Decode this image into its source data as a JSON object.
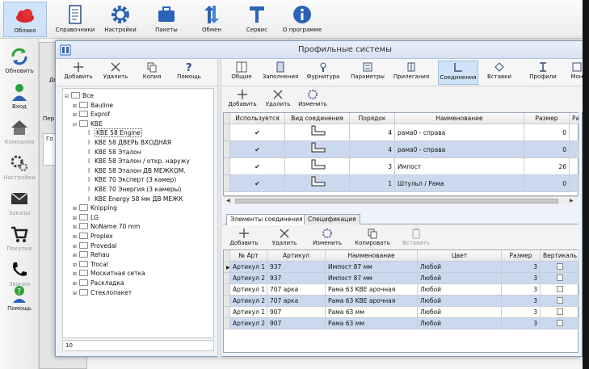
{
  "main_toolbar": {
    "items": [
      {
        "label": "Облако",
        "icon": "cloud-icon"
      },
      {
        "label": "Справочники",
        "icon": "book-icon"
      },
      {
        "label": "Настройки",
        "icon": "gear-icon"
      },
      {
        "label": "Пакеты",
        "icon": "briefcase-icon"
      },
      {
        "label": "Обмен",
        "icon": "exchange-arrows-icon"
      },
      {
        "label": "Сервис",
        "icon": "tool-icon"
      },
      {
        "label": "О программе",
        "icon": "info-icon"
      }
    ]
  },
  "sidebar": {
    "items": [
      {
        "label": "Обновить",
        "icon": "refresh-icon"
      },
      {
        "label": "Вход",
        "icon": "user-icon"
      },
      {
        "label": "Компания",
        "icon": "house-icon"
      },
      {
        "label": "Настройки",
        "icon": "gears-icon"
      },
      {
        "label": "Заказы",
        "icon": "mail-icon"
      },
      {
        "label": "Покупки",
        "icon": "cart-icon"
      },
      {
        "label": "Звонки",
        "icon": "phone-icon"
      },
      {
        "label": "Помощь",
        "icon": "help-icon"
      }
    ]
  },
  "background_window": {
    "fragments": [
      "Де",
      "Пер",
      "Го"
    ]
  },
  "dialog": {
    "title": "Профильные системы"
  },
  "left_toolbar": {
    "items": [
      {
        "label": "Добавить",
        "icon": "plus-icon"
      },
      {
        "label": "Удалить",
        "icon": "x-icon"
      },
      {
        "label": "Копия",
        "icon": "copy-icon"
      },
      {
        "label": "Помощь",
        "icon": "question-icon"
      }
    ]
  },
  "tree": {
    "items": [
      {
        "label": "Все",
        "level": 0,
        "kind": "folder",
        "expander": "-"
      },
      {
        "label": "Bauline",
        "level": 1,
        "kind": "folder",
        "expander": "+"
      },
      {
        "label": "Exprof",
        "level": 1,
        "kind": "folder",
        "expander": "+"
      },
      {
        "label": "KBE",
        "level": 1,
        "kind": "folder",
        "expander": "-"
      },
      {
        "label": "KBE 58 Engine",
        "level": 2,
        "kind": "profile",
        "selected": true
      },
      {
        "label": "KBE 58 ДВЕРЬ ВХОДНАЯ",
        "level": 2,
        "kind": "profile"
      },
      {
        "label": "KBE 58 Эталон",
        "level": 2,
        "kind": "profile"
      },
      {
        "label": "KBE 58 Эталон / откр. наружу",
        "level": 2,
        "kind": "profile"
      },
      {
        "label": "KBE 58 Эталон ДВ МЕЖКОМ.",
        "level": 2,
        "kind": "profile"
      },
      {
        "label": "KBE 70 Эксперт (3 камер)",
        "level": 2,
        "kind": "profile"
      },
      {
        "label": "KBE 70 Энергия (3 камеры)",
        "level": 2,
        "kind": "profile"
      },
      {
        "label": "KBE Energy 58 мм ДВ МЕЖК",
        "level": 2,
        "kind": "profile"
      },
      {
        "label": "Knipping",
        "level": 1,
        "kind": "folder",
        "expander": "+"
      },
      {
        "label": "LG",
        "level": 1,
        "kind": "folder",
        "expander": "+"
      },
      {
        "label": "NoName 70 mm",
        "level": 1,
        "kind": "folder",
        "expander": "+"
      },
      {
        "label": "Proplex",
        "level": 1,
        "kind": "folder",
        "expander": "+"
      },
      {
        "label": "Provedal",
        "level": 1,
        "kind": "folder",
        "expander": "+"
      },
      {
        "label": "Rehau",
        "level": 1,
        "kind": "folder",
        "expander": "+"
      },
      {
        "label": "Trocal",
        "level": 1,
        "kind": "folder",
        "expander": "+"
      },
      {
        "label": "Москитная сетка",
        "level": 1,
        "kind": "folder",
        "expander": "+"
      },
      {
        "label": "Раскладка",
        "level": 1,
        "kind": "folder",
        "expander": "+"
      },
      {
        "label": "Стеклопакет",
        "level": 1,
        "kind": "folder",
        "expander": "+"
      }
    ],
    "footer": "10"
  },
  "right_toolbar": {
    "items": [
      {
        "label": "Общие",
        "icon": "window-icon"
      },
      {
        "label": "Заполнения",
        "icon": "fill-icon"
      },
      {
        "label": "Фурнитура",
        "icon": "hardware-icon"
      },
      {
        "label": "Параметры",
        "icon": "params-icon"
      },
      {
        "label": "Прилегания",
        "icon": "adjoin-icon"
      },
      {
        "label": "Соединения",
        "icon": "joint-icon",
        "active": true
      },
      {
        "label": "Вставки",
        "icon": "insert-icon"
      },
      {
        "label": "Профили",
        "icon": "profile-icon"
      },
      {
        "label": "Мон",
        "icon": "mount-icon"
      }
    ],
    "sub_items": [
      {
        "label": "Добавить",
        "icon": "plus-icon"
      },
      {
        "label": "Удалить",
        "icon": "x-icon"
      },
      {
        "label": "Изменить",
        "icon": "edit-icon"
      }
    ]
  },
  "connections_grid": {
    "columns": [
      "Используется",
      "Вид соединения",
      "Порядок",
      "Наименование",
      "Размер",
      "Разм"
    ],
    "rows": [
      {
        "used": "✔",
        "order": "4",
        "name": "рама0 - справа",
        "size": "0"
      },
      {
        "used": "✔",
        "order": "4",
        "name": "рама0 - справа",
        "size": "0"
      },
      {
        "used": "✔",
        "order": "3",
        "name": "Импост",
        "size": "26"
      },
      {
        "used": "✔",
        "order": "1",
        "name": "Штульп / Рама",
        "size": "0"
      }
    ]
  },
  "bottom_tabs": {
    "items": [
      {
        "label": "Элементы соединения",
        "active": true
      },
      {
        "label": "Спецификация",
        "active": false
      }
    ]
  },
  "bottom_toolbar": {
    "items": [
      {
        "label": "Добавить",
        "icon": "plus-icon"
      },
      {
        "label": "Удалить",
        "icon": "x-icon"
      },
      {
        "label": "Изменить",
        "icon": "edit-icon"
      },
      {
        "label": "Копировать",
        "icon": "copy-icon"
      },
      {
        "label": "Вставить",
        "icon": "paste-icon",
        "disabled": true
      }
    ]
  },
  "elements_grid": {
    "columns": [
      "№ Арт",
      "Артикул",
      "Наименование",
      "Цвет",
      "Размер",
      "Вертикаль"
    ],
    "rows": [
      {
        "num": "Артикул 1",
        "article": "937",
        "name": "Импост 87 мм",
        "color": "Любой",
        "size": "3"
      },
      {
        "num": "Артикул 2",
        "article": "937",
        "name": "Импост 87 мм",
        "color": "Любой",
        "size": "3"
      },
      {
        "num": "Артикул 1",
        "article": "707 арка",
        "name": "Рама 63 KBE арочная",
        "color": "Любой",
        "size": "3"
      },
      {
        "num": "Артикул 2",
        "article": "707 арка",
        "name": "Рама 63 KBE арочная",
        "color": "Любой",
        "size": "3"
      },
      {
        "num": "Артикул 1",
        "article": "907",
        "name": "Рама 63 мм",
        "color": "Любой",
        "size": "3"
      },
      {
        "num": "Артикул 2",
        "article": "907",
        "name": "Рама 63 мм",
        "color": "Любой",
        "size": "3"
      }
    ]
  },
  "colors": {
    "accent": "#2a63b8",
    "highlight_row": "#cad9ee",
    "cloud": "#d9262b"
  }
}
